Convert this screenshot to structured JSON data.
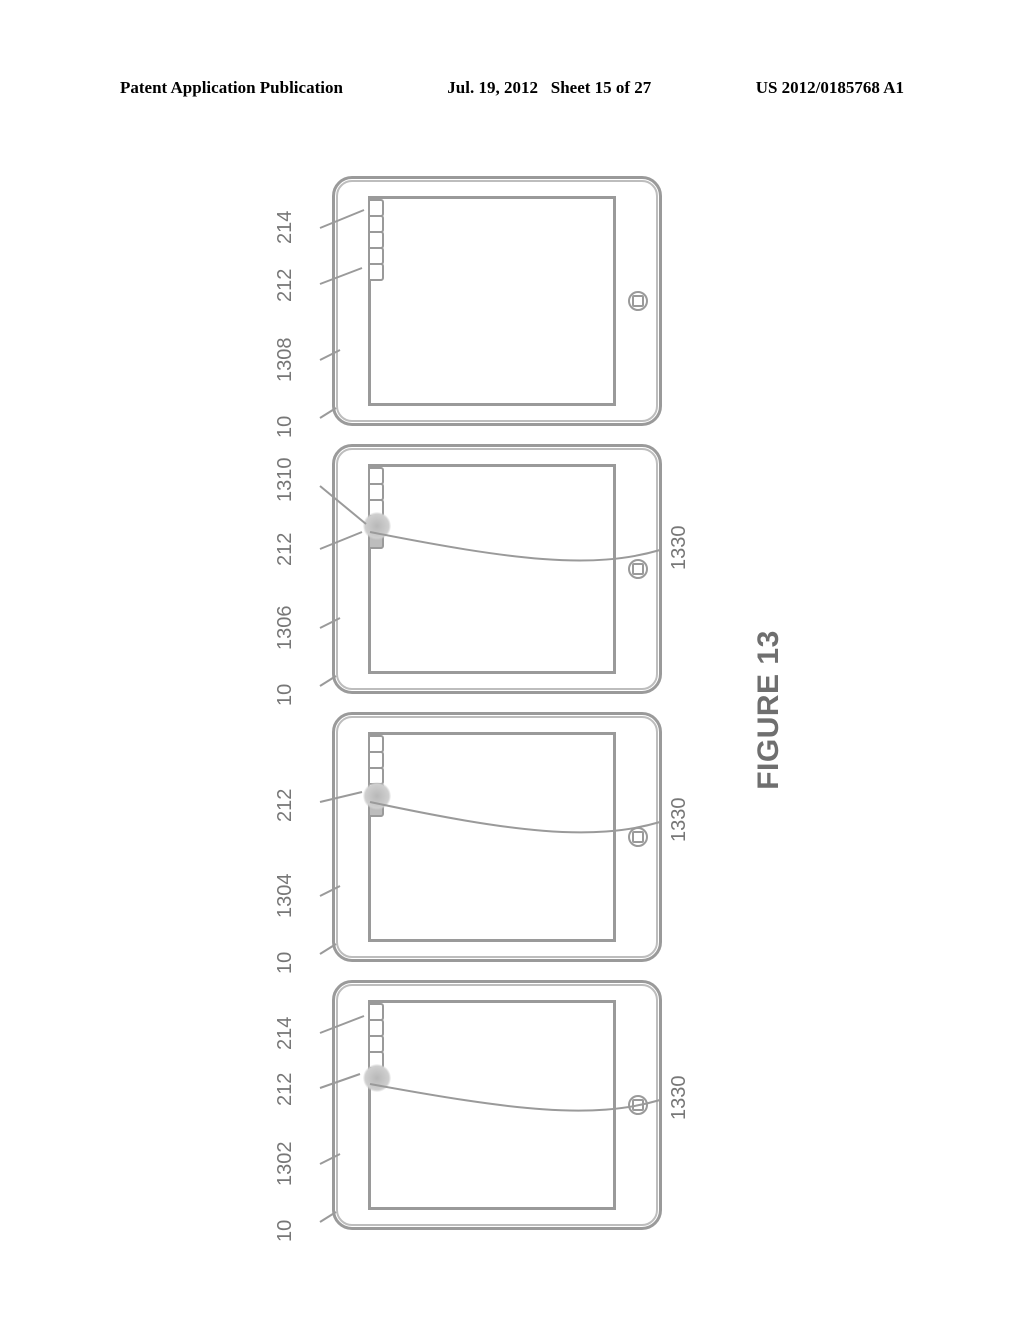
{
  "header": {
    "left": "Patent Application Publication",
    "date": "Jul. 19, 2012",
    "sheet": "Sheet 15 of 27",
    "pubno": "US 2012/0185768 A1"
  },
  "figure": {
    "caption": "FIGURE 13",
    "refs": {
      "device": "10",
      "screen_state_a": "1302",
      "screen_state_b": "1304",
      "screen_state_c": "1306",
      "screen_state_d": "1308",
      "tabbar": "212",
      "tab_last": "214",
      "tab_sel": "1310",
      "swipe": "1330"
    }
  }
}
